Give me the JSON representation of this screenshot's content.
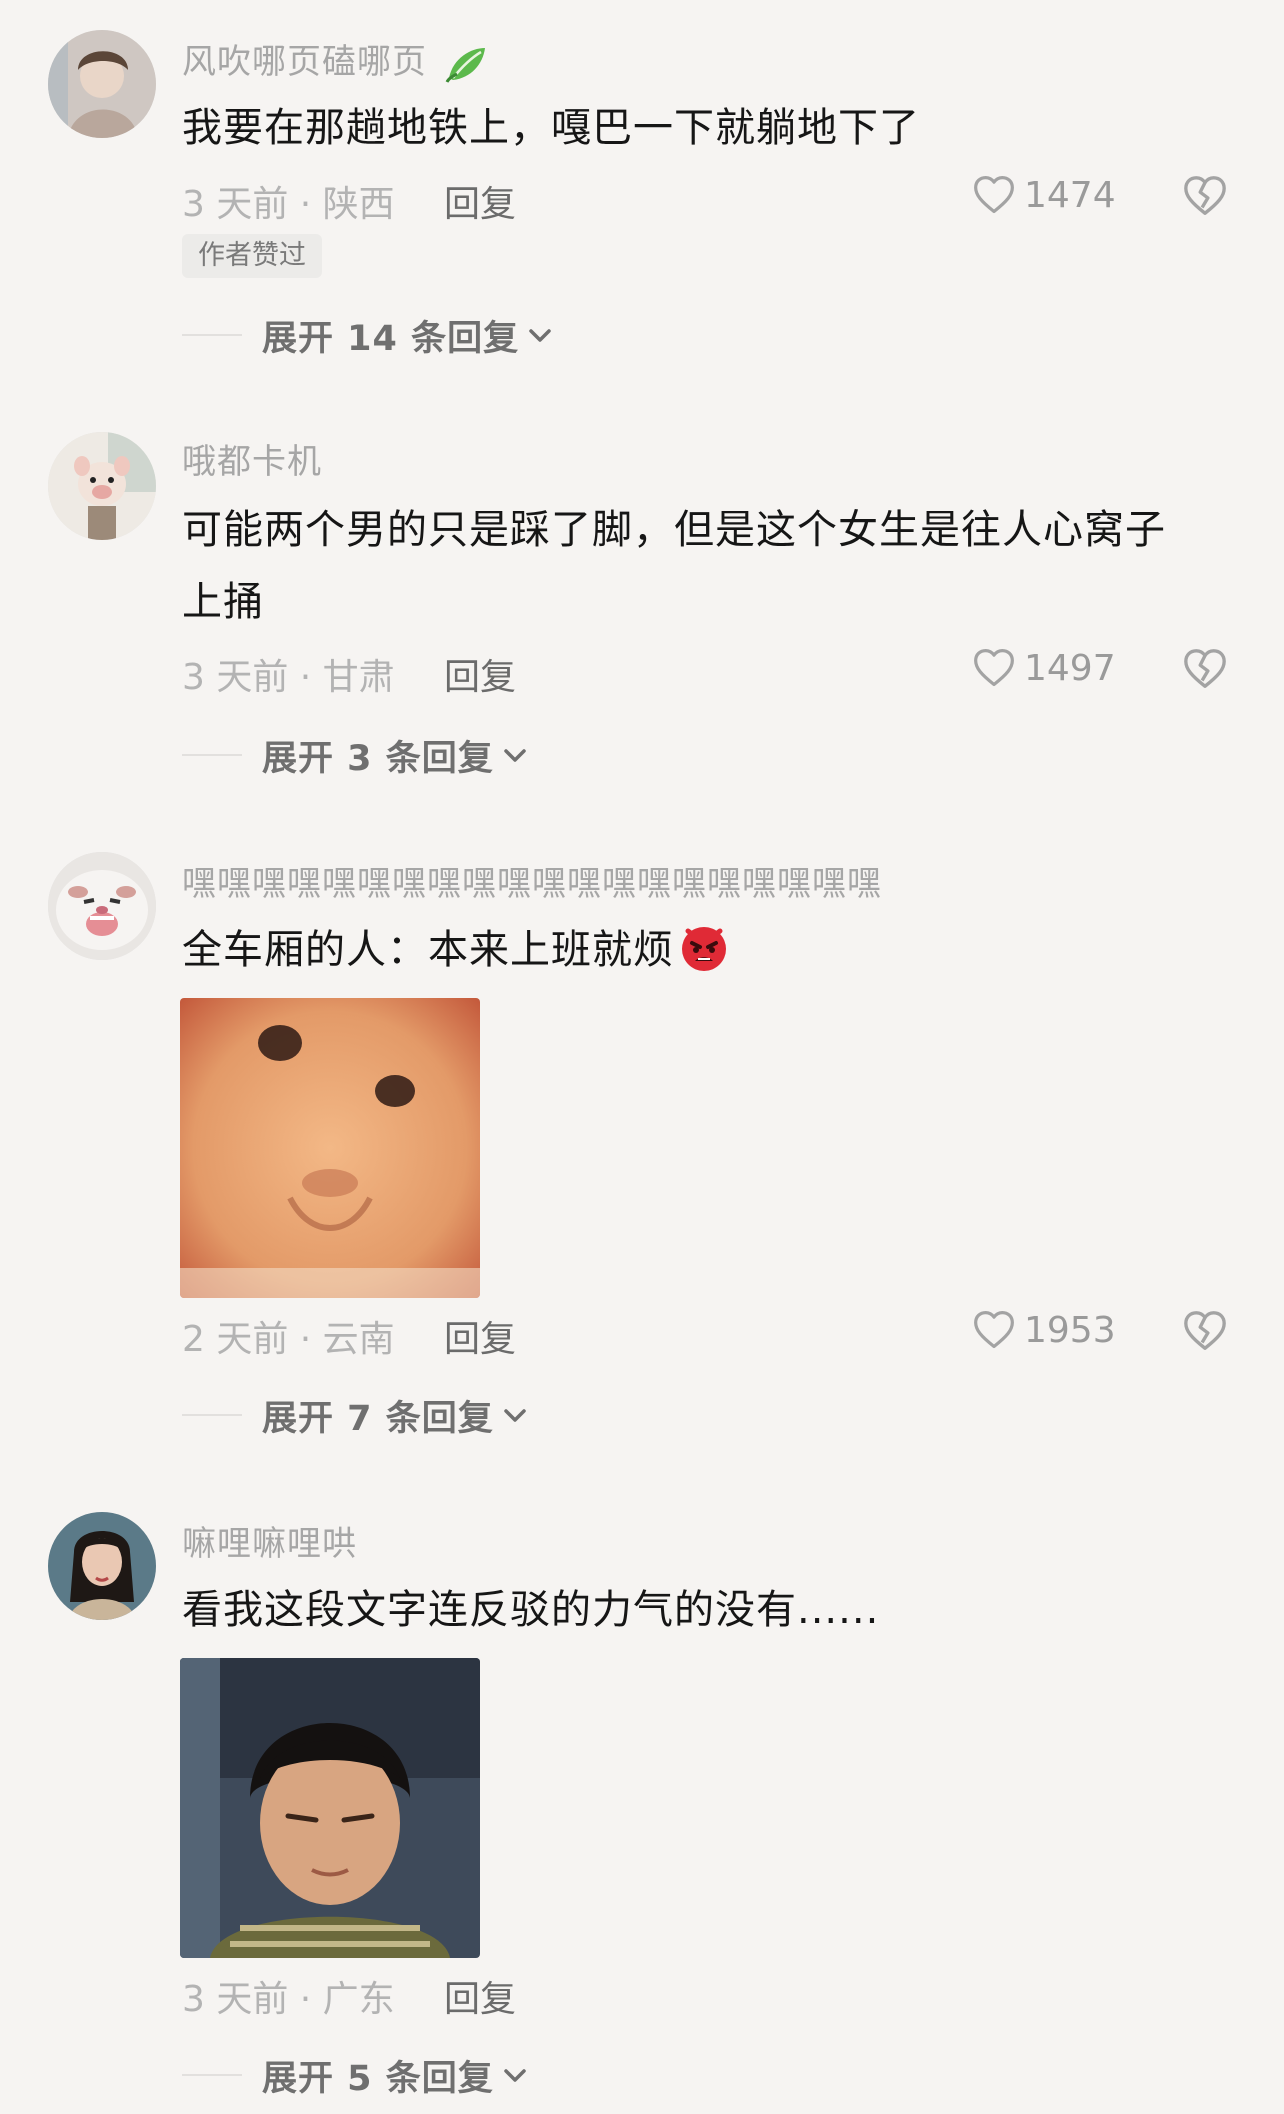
{
  "comments": [
    {
      "username": "风吹哪页磕哪页",
      "content": "我要在那趟地铁上，嘎巴一下就躺地下了",
      "time_location": "3 天前 · 陕西",
      "reply_label": "回复",
      "likes": "1474",
      "author_liked": "作者赞过",
      "expand_label": "展开 14 条回复"
    },
    {
      "username": "哦都卡机",
      "content": "可能两个男的只是踩了脚，但是这个女生是往人心窝子上捅",
      "time_location": "3 天前 · 甘肃",
      "reply_label": "回复",
      "likes": "1497",
      "expand_label": "展开 3 条回复"
    },
    {
      "username": "嘿嘿嘿嘿嘿嘿嘿嘿嘿嘿嘿嘿嘿嘿嘿嘿嘿嘿嘿嘿",
      "content": "全车厢的人：本来上班就烦",
      "time_location": "2 天前 · 云南",
      "reply_label": "回复",
      "likes": "1953",
      "expand_label": "展开 7 条回复"
    },
    {
      "username": "嘛哩嘛哩哄",
      "content": "看我这段文字连反驳的力气的没有......",
      "time_location": "3 天前 · 广东",
      "reply_label": "回复",
      "expand_label": "展开 5 条回复"
    }
  ],
  "colors": {
    "background": "#f6f4f2",
    "text_primary": "#161616",
    "text_muted": "#a6a6a6",
    "reply": "#6b6b6b"
  },
  "icons": {
    "like": "heart-outline-icon",
    "dislike": "broken-heart-icon",
    "expand": "chevron-down-icon",
    "badge": "leaf-icon",
    "emoji": "angry-face-emoji-icon"
  }
}
